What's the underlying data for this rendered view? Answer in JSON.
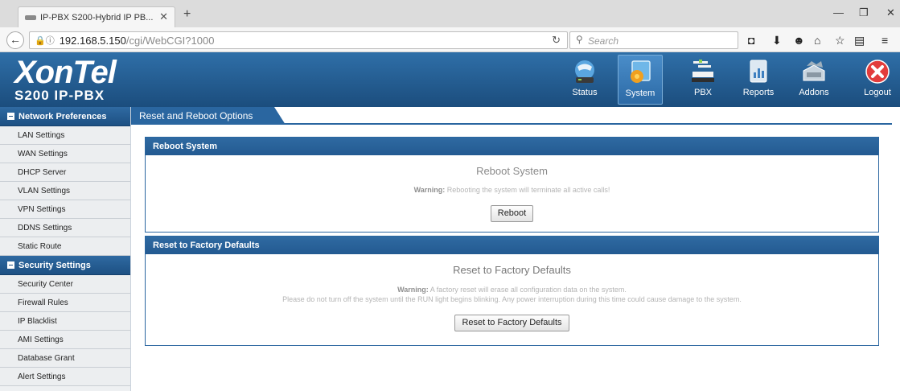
{
  "browser": {
    "tab_title": "IP-PBX S200-Hybrid IP PB...",
    "url_host": "192.168.5.150",
    "url_path": "/cgi/WebCGI?1000",
    "search_placeholder": "Search"
  },
  "header": {
    "brand": "XonTel",
    "model": "S200 IP-PBX",
    "nav": [
      {
        "label": "Status",
        "icon": "status-icon"
      },
      {
        "label": "System",
        "icon": "system-icon",
        "active": true
      },
      {
        "label": "PBX",
        "icon": "pbx-icon"
      },
      {
        "label": "Reports",
        "icon": "reports-icon"
      },
      {
        "label": "Addons",
        "icon": "addons-icon"
      },
      {
        "label": "Logout",
        "icon": "logout-icon"
      }
    ]
  },
  "sidebar": {
    "network": {
      "title": "Network Preferences",
      "items": [
        "LAN Settings",
        "WAN Settings",
        "DHCP Server",
        "VLAN Settings",
        "VPN Settings",
        "DDNS Settings",
        "Static Route"
      ]
    },
    "security": {
      "title": "Security Settings",
      "items": [
        "Security Center",
        "Firewall Rules",
        "IP Blacklist",
        "AMI Settings",
        "Database Grant",
        "Alert Settings"
      ]
    }
  },
  "main": {
    "breadcrumb": "Reset and Reboot Options",
    "reboot": {
      "header": "Reboot System",
      "title": "Reboot System",
      "warning_label": "Warning:",
      "warning_text": "Rebooting the system will terminate all active calls!",
      "button": "Reboot"
    },
    "factory": {
      "header": "Reset to Factory Defaults",
      "title": "Reset to Factory Defaults",
      "warning_label": "Warning:",
      "warning_text": "A factory reset will erase all configuration data on the system.",
      "warning_text2": "Please do not turn off the system until the RUN light begins blinking. Any power interruption during this time could cause damage to the system.",
      "button": "Reset to Factory Defaults"
    }
  },
  "colors": {
    "primary_blue": "#2a66a0",
    "header_blue": "#1b4d7d",
    "logout_red": "#e23c3c"
  }
}
